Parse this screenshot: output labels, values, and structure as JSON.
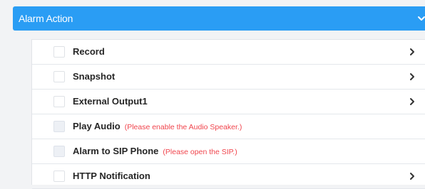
{
  "header": {
    "title": "Alarm Action",
    "chevron_icon": "chevron-down-icon",
    "bg_color": "#2a9df4"
  },
  "actions": [
    {
      "label": "Record",
      "note": "",
      "checked": false,
      "disabled": false,
      "has_arrow": true
    },
    {
      "label": "Snapshot",
      "note": "",
      "checked": false,
      "disabled": false,
      "has_arrow": true
    },
    {
      "label": "External Output1",
      "note": "",
      "checked": false,
      "disabled": false,
      "has_arrow": true
    },
    {
      "label": "Play Audio",
      "note": "(Please enable the Audio Speaker.)",
      "checked": false,
      "disabled": true,
      "has_arrow": false
    },
    {
      "label": "Alarm to SIP Phone",
      "note": "(Please open the SIP.)",
      "checked": false,
      "disabled": true,
      "has_arrow": false
    },
    {
      "label": "HTTP Notification",
      "note": "",
      "checked": false,
      "disabled": false,
      "has_arrow": true
    }
  ],
  "colors": {
    "note": "#f0444c",
    "text": "#262626"
  }
}
